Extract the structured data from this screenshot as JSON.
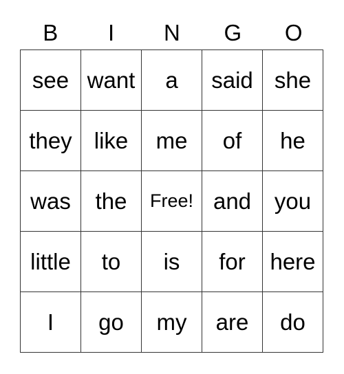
{
  "header": [
    "B",
    "I",
    "N",
    "G",
    "O"
  ],
  "rows": [
    [
      "see",
      "want",
      "a",
      "said",
      "she"
    ],
    [
      "they",
      "like",
      "me",
      "of",
      "he"
    ],
    [
      "was",
      "the",
      "Free!",
      "and",
      "you"
    ],
    [
      "little",
      "to",
      "is",
      "for",
      "here"
    ],
    [
      "I",
      "go",
      "my",
      "are",
      "do"
    ]
  ],
  "free_label": "Free!"
}
